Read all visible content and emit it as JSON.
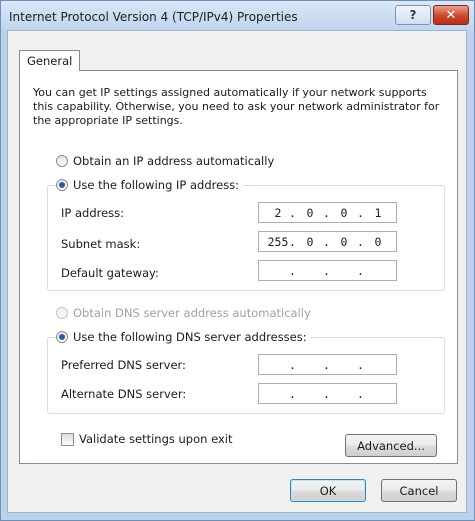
{
  "window": {
    "title": "Internet Protocol Version 4 (TCP/IPv4) Properties",
    "help_label": "?",
    "close_label": "✕"
  },
  "tabs": [
    {
      "label": "General"
    }
  ],
  "intro_text": "You can get IP settings assigned automatically if your network supports this capability. Otherwise, you need to ask your network administrator for the appropriate IP settings.",
  "ip_section": {
    "auto_label": "Obtain an IP address automatically",
    "manual_label": "Use the following IP address:",
    "selected": "manual",
    "fields": [
      {
        "label": "IP address:",
        "octets": [
          "2",
          "0",
          "0",
          "1"
        ]
      },
      {
        "label": "Subnet mask:",
        "octets": [
          "255",
          "0",
          "0",
          "0"
        ]
      },
      {
        "label": "Default gateway:",
        "octets": [
          "",
          "",
          "",
          ""
        ]
      }
    ]
  },
  "dns_section": {
    "auto_label": "Obtain DNS server address automatically",
    "manual_label": "Use the following DNS server addresses:",
    "selected": "manual",
    "auto_disabled": true,
    "fields": [
      {
        "label": "Preferred DNS server:",
        "octets": [
          "",
          "",
          "",
          ""
        ]
      },
      {
        "label": "Alternate DNS server:",
        "octets": [
          "",
          "",
          "",
          ""
        ]
      }
    ]
  },
  "validate_label": "Validate settings upon exit",
  "validate_checked": false,
  "buttons": {
    "advanced": "Advanced...",
    "ok": "OK",
    "cancel": "Cancel"
  },
  "colors": {
    "frame": "#bcd2ea",
    "close_button": "#c9462a",
    "radio_dot": "#2f59a6"
  },
  "icons": {
    "help": "question-mark",
    "close": "x-mark"
  }
}
